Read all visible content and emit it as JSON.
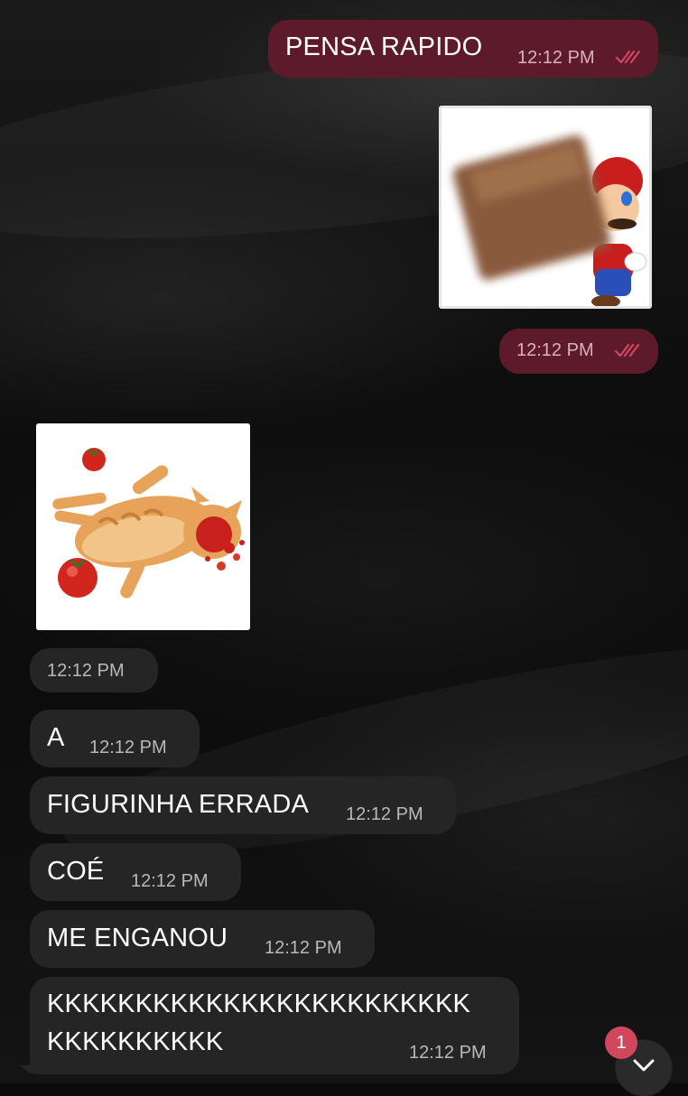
{
  "colors": {
    "outgoing_bubble": "#5c1a2a",
    "incoming_bubble": "#252525",
    "read_ticks": "#d1475d",
    "badge": "#d1475d"
  },
  "messages": [
    {
      "direction": "outgoing",
      "type": "text",
      "text": "PENSA RAPIDO",
      "time": "12:12 PM",
      "status_icon": "double-check-icon"
    },
    {
      "direction": "outgoing",
      "type": "sticker",
      "sticker": "mario-brick-sticker",
      "time": "12:12 PM",
      "status_icon": "double-check-icon"
    },
    {
      "direction": "incoming",
      "type": "sticker",
      "sticker": "cat-tomato-sticker",
      "time": "12:12 PM"
    },
    {
      "direction": "incoming",
      "type": "text",
      "text": "A",
      "time": "12:12 PM"
    },
    {
      "direction": "incoming",
      "type": "text",
      "text": "FIGURINHA ERRADA",
      "time": "12:12 PM"
    },
    {
      "direction": "incoming",
      "type": "text",
      "text": "COÉ",
      "time": "12:12 PM"
    },
    {
      "direction": "incoming",
      "type": "text",
      "text": "ME ENGANOU",
      "time": "12:12 PM"
    },
    {
      "direction": "incoming",
      "type": "text",
      "text_line1": "KKKKKKKKKKKKKKKKKKKKKKKK",
      "text_line2": "KKKKKKKKKK",
      "time": "12:12 PM"
    }
  ],
  "scroll_down": {
    "icon": "chevron-down-icon",
    "unread_count": "1"
  }
}
